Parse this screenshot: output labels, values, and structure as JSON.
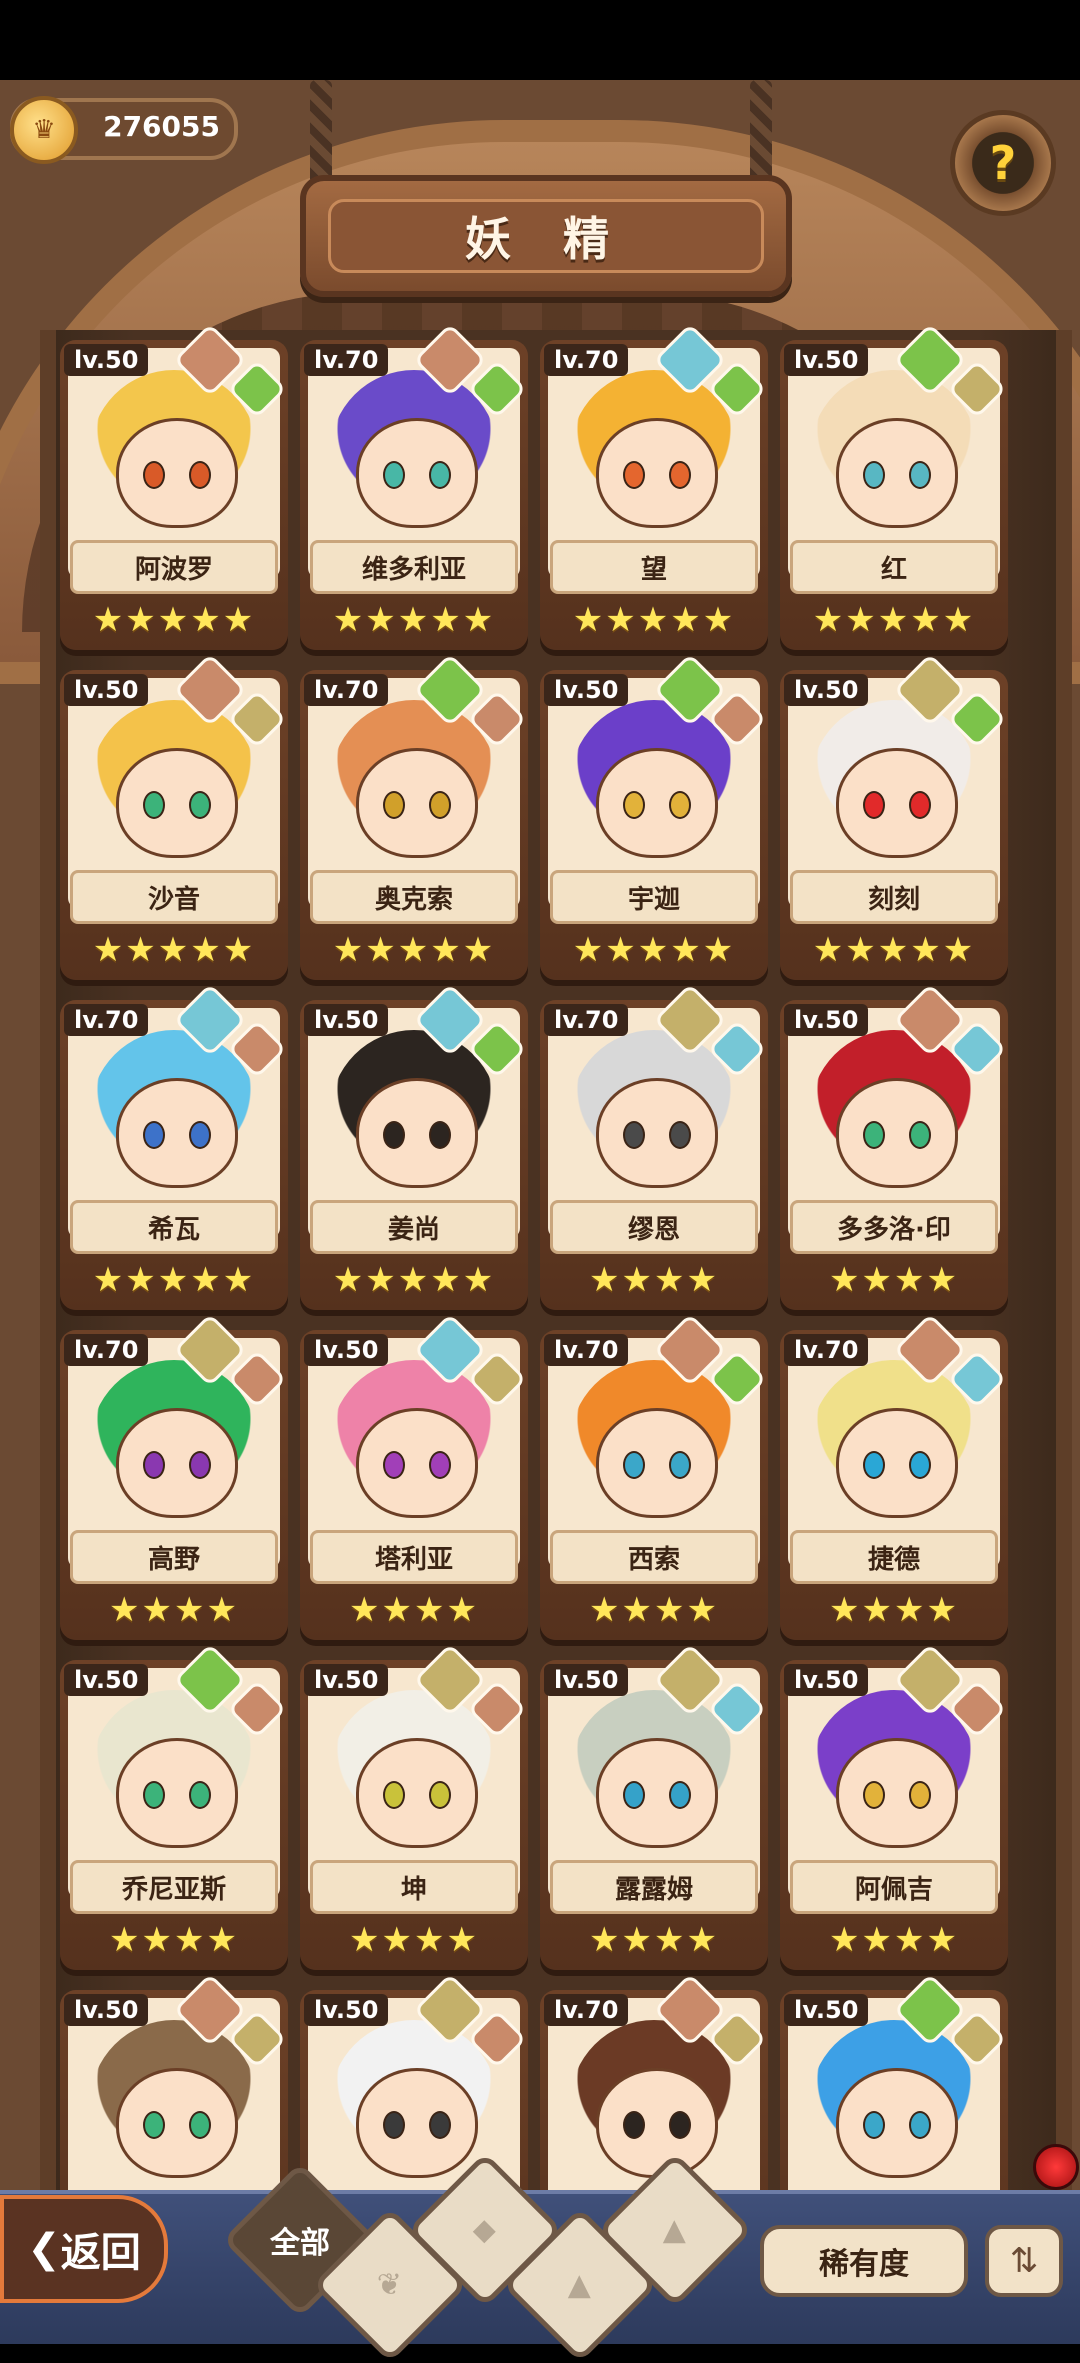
{
  "header": {
    "title": "妖 精",
    "currency": "276055",
    "help_label": "?"
  },
  "fairies": [
    {
      "level": "lv.50",
      "name": "阿波罗",
      "stars": "★★★★★",
      "main": "#c98a6a",
      "sub": "#7cc34a",
      "hair": "#f3c64c",
      "eye": "#d95a28"
    },
    {
      "level": "lv.70",
      "name": "维多利亚",
      "stars": "★★★★★",
      "main": "#c98a6a",
      "sub": "#7cc34a",
      "hair": "#6a4bc9",
      "eye": "#48b7a6"
    },
    {
      "level": "lv.70",
      "name": "望",
      "stars": "★★★★★",
      "main": "#76c7d6",
      "sub": "#7cc34a",
      "hair": "#f4b233",
      "eye": "#e4662e"
    },
    {
      "level": "lv.50",
      "name": "红",
      "stars": "★★★★★",
      "main": "#7cc34a",
      "sub": "#c4b06a",
      "hair": "#f4dcb7",
      "eye": "#58b7c3"
    },
    {
      "level": "lv.50",
      "name": "沙音",
      "stars": "★★★★★",
      "main": "#c98a6a",
      "sub": "#c4b06a",
      "hair": "#f4c24a",
      "eye": "#3cb37a"
    },
    {
      "level": "lv.70",
      "name": "奥克索",
      "stars": "★★★★★",
      "main": "#7cc34a",
      "sub": "#c98a6a",
      "hair": "#e48f54",
      "eye": "#d1a02a"
    },
    {
      "level": "lv.50",
      "name": "宇迦",
      "stars": "★★★★★",
      "main": "#7cc34a",
      "sub": "#c98a6a",
      "hair": "#6b3fc9",
      "eye": "#e2b23a"
    },
    {
      "level": "lv.50",
      "name": "刻刻",
      "stars": "★★★★★",
      "main": "#c4b06a",
      "sub": "#7cc34a",
      "hair": "#f1ece8",
      "eye": "#e12a2a"
    },
    {
      "level": "lv.70",
      "name": "希瓦",
      "stars": "★★★★★",
      "main": "#76c7d6",
      "sub": "#c98a6a",
      "hair": "#63c4ea",
      "eye": "#3d72c9"
    },
    {
      "level": "lv.50",
      "name": "姜尚",
      "stars": "★★★★★",
      "main": "#76c7d6",
      "sub": "#7cc34a",
      "hair": "#2c2520",
      "eye": "#2c2520"
    },
    {
      "level": "lv.70",
      "name": "缪恩",
      "stars": "★★★★",
      "main": "#c4b06a",
      "sub": "#76c7d6",
      "hair": "#d8d8d8",
      "eye": "#4a4a4a"
    },
    {
      "level": "lv.50",
      "name": "多多洛·印",
      "stars": "★★★★",
      "main": "#c98a6a",
      "sub": "#76c7d6",
      "hair": "#c21f2a",
      "eye": "#3cb37a"
    },
    {
      "level": "lv.70",
      "name": "高野",
      "stars": "★★★★",
      "main": "#c4b06a",
      "sub": "#c98a6a",
      "hair": "#2fb45c",
      "eye": "#8a38b0"
    },
    {
      "level": "lv.50",
      "name": "塔利亚",
      "stars": "★★★★",
      "main": "#76c7d6",
      "sub": "#c4b06a",
      "hair": "#ee82a8",
      "eye": "#a13fb8"
    },
    {
      "level": "lv.70",
      "name": "西索",
      "stars": "★★★★",
      "main": "#c98a6a",
      "sub": "#7cc34a",
      "hair": "#f0892a",
      "eye": "#3ba7c9"
    },
    {
      "level": "lv.70",
      "name": "捷德",
      "stars": "★★★★",
      "main": "#c98a6a",
      "sub": "#76c7d6",
      "hair": "#f0e08a",
      "eye": "#2aa7d6"
    },
    {
      "level": "lv.50",
      "name": "乔尼亚斯",
      "stars": "★★★★",
      "main": "#7cc34a",
      "sub": "#c98a6a",
      "hair": "#e9e6cf",
      "eye": "#3cb37a"
    },
    {
      "level": "lv.50",
      "name": "坤",
      "stars": "★★★★",
      "main": "#c4b06a",
      "sub": "#c98a6a",
      "hair": "#f2efe6",
      "eye": "#c9c23a"
    },
    {
      "level": "lv.50",
      "name": "露露姆",
      "stars": "★★★★",
      "main": "#c4b06a",
      "sub": "#76c7d6",
      "hair": "#c8cfc0",
      "eye": "#35a2c9"
    },
    {
      "level": "lv.50",
      "name": "阿佩吉",
      "stars": "★★★★",
      "main": "#c4b06a",
      "sub": "#c98a6a",
      "hair": "#7b3fc9",
      "eye": "#e2b23a"
    },
    {
      "level": "lv.50",
      "name": "",
      "stars": "",
      "main": "#c98a6a",
      "sub": "#c4b06a",
      "hair": "#8a6a4a",
      "eye": "#3cb37a"
    },
    {
      "level": "lv.50",
      "name": "",
      "stars": "",
      "main": "#c4b06a",
      "sub": "#c98a6a",
      "hair": "#f2f2f2",
      "eye": "#3a3a3a"
    },
    {
      "level": "lv.70",
      "name": "",
      "stars": "",
      "main": "#c98a6a",
      "sub": "#c4b06a",
      "hair": "#6b3a25",
      "eye": "#2c2520"
    },
    {
      "level": "lv.50",
      "name": "",
      "stars": "",
      "main": "#7cc34a",
      "sub": "#c4b06a",
      "hair": "#3da0e6",
      "eye": "#3ba7c9"
    }
  ],
  "footer": {
    "back_label": "返回",
    "filter_all_label": "全部",
    "rarity_label": "稀有度",
    "sort_icon_label": "⇅"
  }
}
